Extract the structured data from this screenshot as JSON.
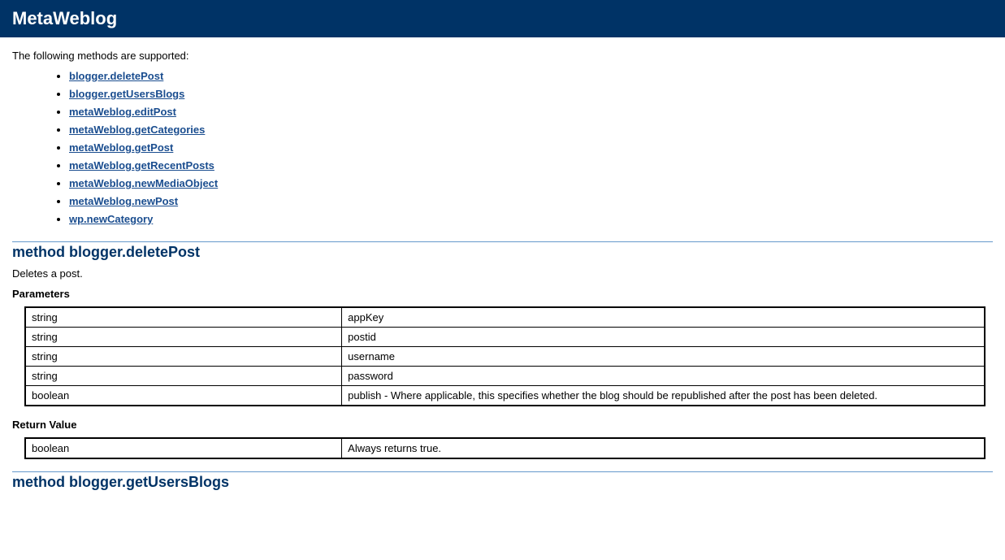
{
  "header": {
    "title": "MetaWeblog"
  },
  "intro": "The following methods are supported:",
  "methods": [
    "blogger.deletePost",
    "blogger.getUsersBlogs",
    "metaWeblog.editPost",
    "metaWeblog.getCategories",
    "metaWeblog.getPost",
    "metaWeblog.getRecentPosts",
    "metaWeblog.newMediaObject",
    "metaWeblog.newPost",
    "wp.newCategory"
  ],
  "method1": {
    "heading": "method blogger.deletePost",
    "desc": "Deletes a post.",
    "params_label": "Parameters",
    "params": [
      {
        "type": "string",
        "desc": "appKey"
      },
      {
        "type": "string",
        "desc": "postid"
      },
      {
        "type": "string",
        "desc": "username"
      },
      {
        "type": "string",
        "desc": "password"
      },
      {
        "type": "boolean",
        "desc": "publish - Where applicable, this specifies whether the blog should be republished after the post has been deleted."
      }
    ],
    "return_label": "Return Value",
    "return": {
      "type": "boolean",
      "desc": "Always returns true."
    }
  },
  "method2": {
    "heading": "method blogger.getUsersBlogs"
  }
}
